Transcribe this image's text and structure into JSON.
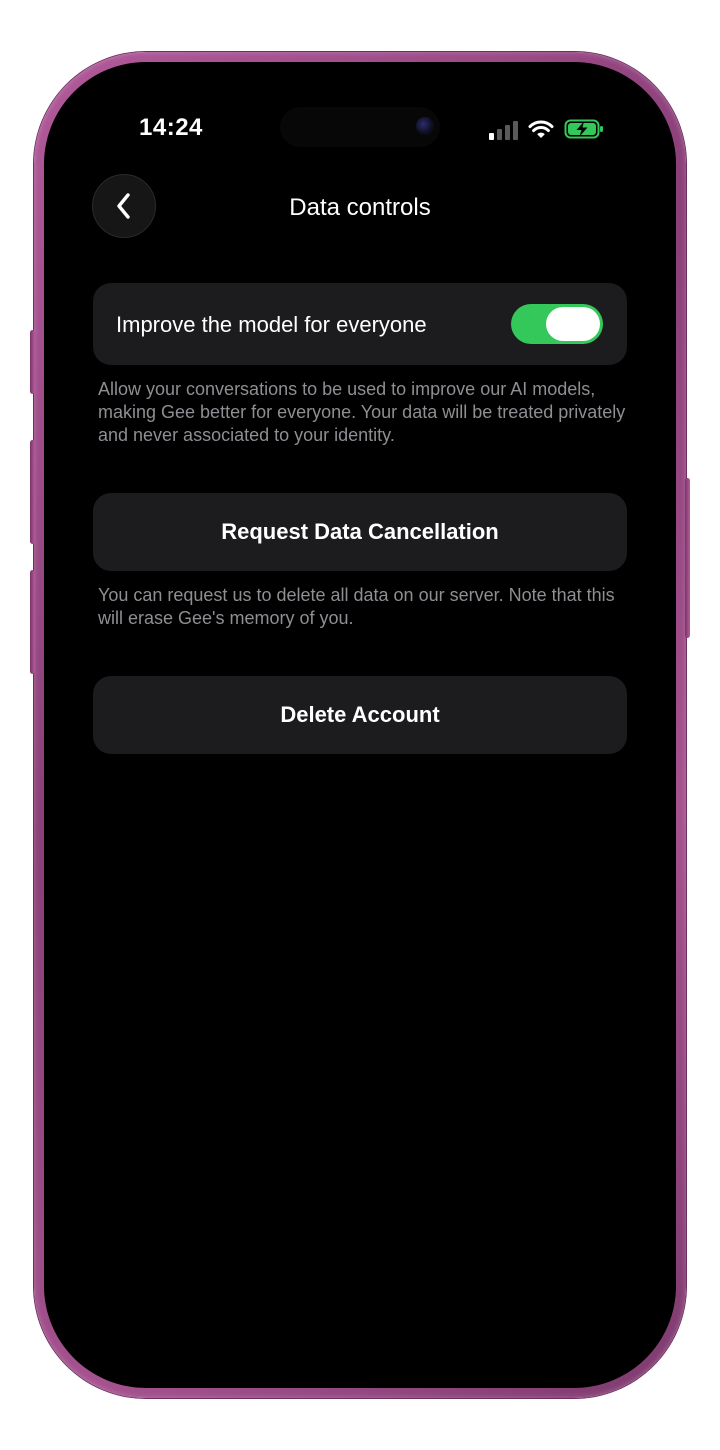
{
  "status_bar": {
    "time": "14:24",
    "icons": [
      "signal-icon",
      "wifi-icon",
      "battery-charging-icon"
    ]
  },
  "header": {
    "back_icon": "chevron-left-icon",
    "title": "Data controls"
  },
  "improve_model": {
    "label": "Improve the model for everyone",
    "enabled": true,
    "description": "Allow your conversations to be used to improve our AI models, making Gee better for everyone. Your data will be treated privately and never associated to your identity."
  },
  "data_cancellation": {
    "button_label": "Request Data Cancellation",
    "description": "You can request us to delete all data on our server. Note that this will erase Gee's memory of you."
  },
  "delete_account": {
    "button_label": "Delete Account"
  },
  "colors": {
    "background": "#000000",
    "card": "#1c1c1e",
    "toggle_on": "#34c759",
    "battery": "#34c759",
    "secondary_text": "#8e8e93",
    "frame": "#a5528f"
  }
}
